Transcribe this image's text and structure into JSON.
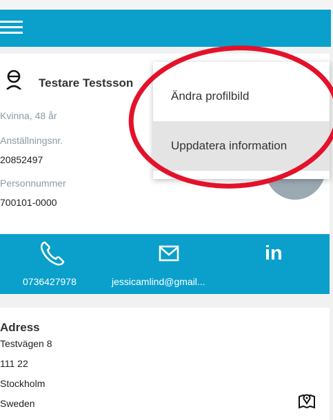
{
  "profile": {
    "name": "Testare Testsson",
    "gender_age": "Kvinna, 48 år",
    "employee_no_label": "Anställningsnr.",
    "employee_no": "20852497",
    "personal_no_label": "Personnummer",
    "personal_no": "700101-0000"
  },
  "contact": {
    "phone": "0736427978",
    "email": "jessicamlind@gmail...",
    "linkedin": "in"
  },
  "address": {
    "title": "Adress",
    "street": "Testvägen 8",
    "postal": "111 22",
    "city": "Stockholm",
    "country": "Sweden"
  },
  "menu": {
    "items": [
      {
        "label": "Ändra profilbild"
      },
      {
        "label": "Uppdatera information"
      }
    ]
  },
  "colors": {
    "accent": "#0aa0cb",
    "annotation": "#e3122a"
  }
}
